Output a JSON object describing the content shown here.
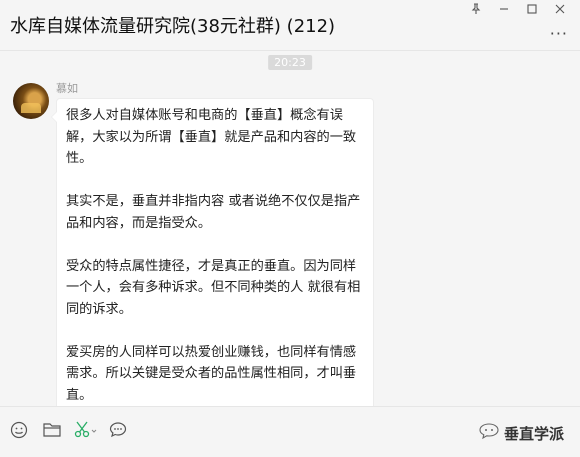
{
  "window": {
    "title": "水库自媒体流量研究院(38元社群) (212)",
    "pin_icon": "pin-icon",
    "minimize_icon": "minimize-icon",
    "maximize_icon": "maximize-icon",
    "close_icon": "close-icon",
    "more_icon": "more-icon",
    "more_label": "···"
  },
  "chat": {
    "timestamp": "20:23",
    "message": {
      "sender": "慕如",
      "paragraphs": [
        "很多人对自媒体账号和电商的【垂直】概念有误解，大家以为所谓【垂直】就是产品和内容的一致性。",
        "其实不是，垂直并非指内容 或者说绝不仅仅是指产品和内容，而是指受众。",
        "受众的特点属性捷径，才是真正的垂直。因为同样一个人，会有多种诉求。但不同种类的人 就很有相同的诉求。",
        "爱买房的人同样可以热爱创业赚钱，也同样有情感需求。所以关键是受众者的品性属性相同，才叫垂直。"
      ]
    }
  },
  "toolbar": {
    "emoji_icon": "emoji-icon",
    "folder_icon": "folder-icon",
    "scissors_icon": "scissors-icon",
    "chat_icon": "chat-bubble-icon",
    "watermark": "垂直学派"
  },
  "colors": {
    "background": "#f5f5f5",
    "bubble": "#ffffff",
    "scissors": "#2aae67"
  }
}
